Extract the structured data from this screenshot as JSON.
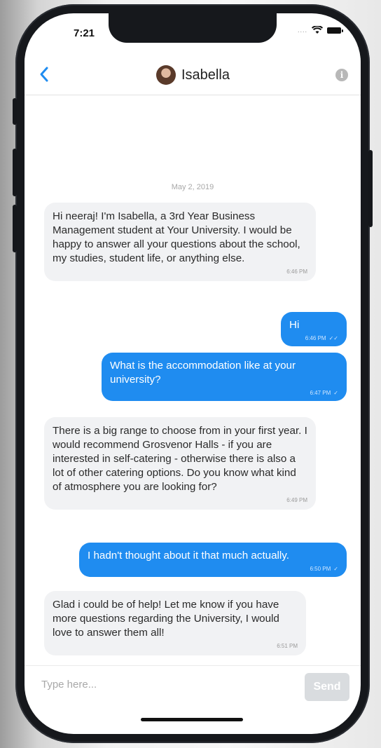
{
  "status": {
    "time": "7:21",
    "signal": "....",
    "wifi_icon": "wifi-icon",
    "battery_icon": "battery-icon"
  },
  "header": {
    "contact_name": "Isabella",
    "back_icon": "chevron-left-icon",
    "info_icon": "info-icon"
  },
  "conversation": {
    "date": "May 2, 2019",
    "messages": [
      {
        "direction": "in",
        "text": "Hi neeraj! I'm Isabella, a 3rd Year Business Management student at Your University. I would be happy to answer all your questions about the school, my studies, student life, or anything else.",
        "time": "6:46 PM"
      },
      {
        "direction": "out",
        "text": "Hi",
        "time": "6:46 PM",
        "status": "✓✓"
      },
      {
        "direction": "out",
        "text": "What is the accommodation like at your university?",
        "time": "6:47 PM",
        "status": "✓"
      },
      {
        "direction": "in",
        "text": "There is a big range to choose from in your first year. I would recommend Grosvenor Halls - if you are interested in self-catering - otherwise there is also a lot of other catering options. Do you know what kind of atmosphere you are looking for?",
        "time": "6:49 PM"
      },
      {
        "direction": "out",
        "text": "I hadn't thought about it that much actually.",
        "time": "6:50 PM",
        "status": "✓"
      },
      {
        "direction": "in",
        "text": "Glad i could be of help! Let me know if you have more questions regarding the University, I would love to answer them all!",
        "time": "6:51 PM"
      }
    ]
  },
  "composer": {
    "placeholder": "Type here...",
    "value": "",
    "send_label": "Send"
  },
  "colors": {
    "accent": "#1f8cf0",
    "incoming_bubble": "#f1f2f4",
    "send_disabled": "#d9dcdf"
  }
}
